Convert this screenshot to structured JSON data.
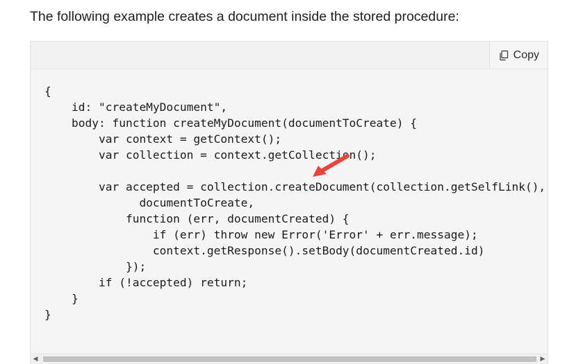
{
  "intro": {
    "text": "The following example creates a document inside the stored procedure:"
  },
  "code_block": {
    "copy_label": "Copy",
    "lines": [
      "{",
      "    id: \"createMyDocument\",",
      "    body: function createMyDocument(documentToCreate) {",
      "        var context = getContext();",
      "        var collection = context.getCollection();",
      "",
      "        var accepted = collection.createDocument(collection.getSelfLink(),",
      "              documentToCreate,",
      "            function (err, documentCreated) {",
      "                if (err) throw new Error('Error' + err.message);",
      "                context.getResponse().setBody(documentCreated.id)",
      "            });",
      "        if (!accepted) return;",
      "    }",
      "}"
    ]
  },
  "colors": {
    "annotation_arrow": "#e8453c",
    "code_background": "#f5f5f5"
  },
  "icons": {
    "copy": "copy-icon",
    "scroll_left": "chevron-left-icon",
    "scroll_right": "chevron-right-icon",
    "annotation": "red-arrow-icon"
  }
}
